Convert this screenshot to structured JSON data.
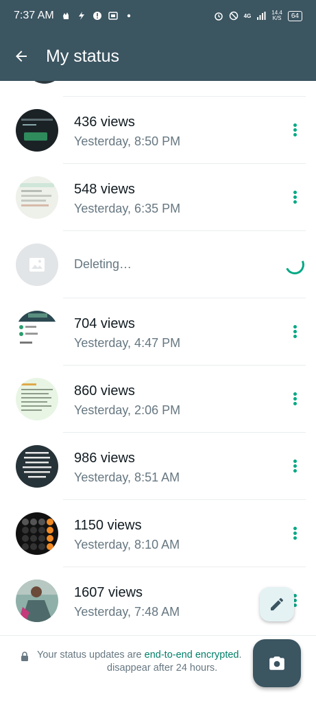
{
  "status_bar": {
    "time": "7:37 AM",
    "net_speed_top": "14.4",
    "net_speed_bottom": "K/S",
    "battery": "64",
    "signal_label": "4G"
  },
  "app_bar": {
    "title": "My status"
  },
  "statuses": [
    {
      "views": "436 views",
      "time": "Yesterday, 8:50 PM"
    },
    {
      "views": "548 views",
      "time": "Yesterday, 6:35 PM"
    },
    {
      "deleting": "Deleting…"
    },
    {
      "views": "704 views",
      "time": "Yesterday, 4:47 PM"
    },
    {
      "views": "860 views",
      "time": "Yesterday, 2:06 PM"
    },
    {
      "views": "986 views",
      "time": "Yesterday, 8:51 AM"
    },
    {
      "views": "1150 views",
      "time": "Yesterday, 8:10 AM"
    },
    {
      "views": "1607 views",
      "time": "Yesterday, 7:48 AM"
    }
  ],
  "footer": {
    "prefix": "Your status updates are ",
    "link": "end-to-end encrypted",
    "line1_end": ".",
    "line2": "disappear after 24 hours."
  },
  "colors": {
    "header": "#3b5561",
    "accent": "#00a884"
  }
}
